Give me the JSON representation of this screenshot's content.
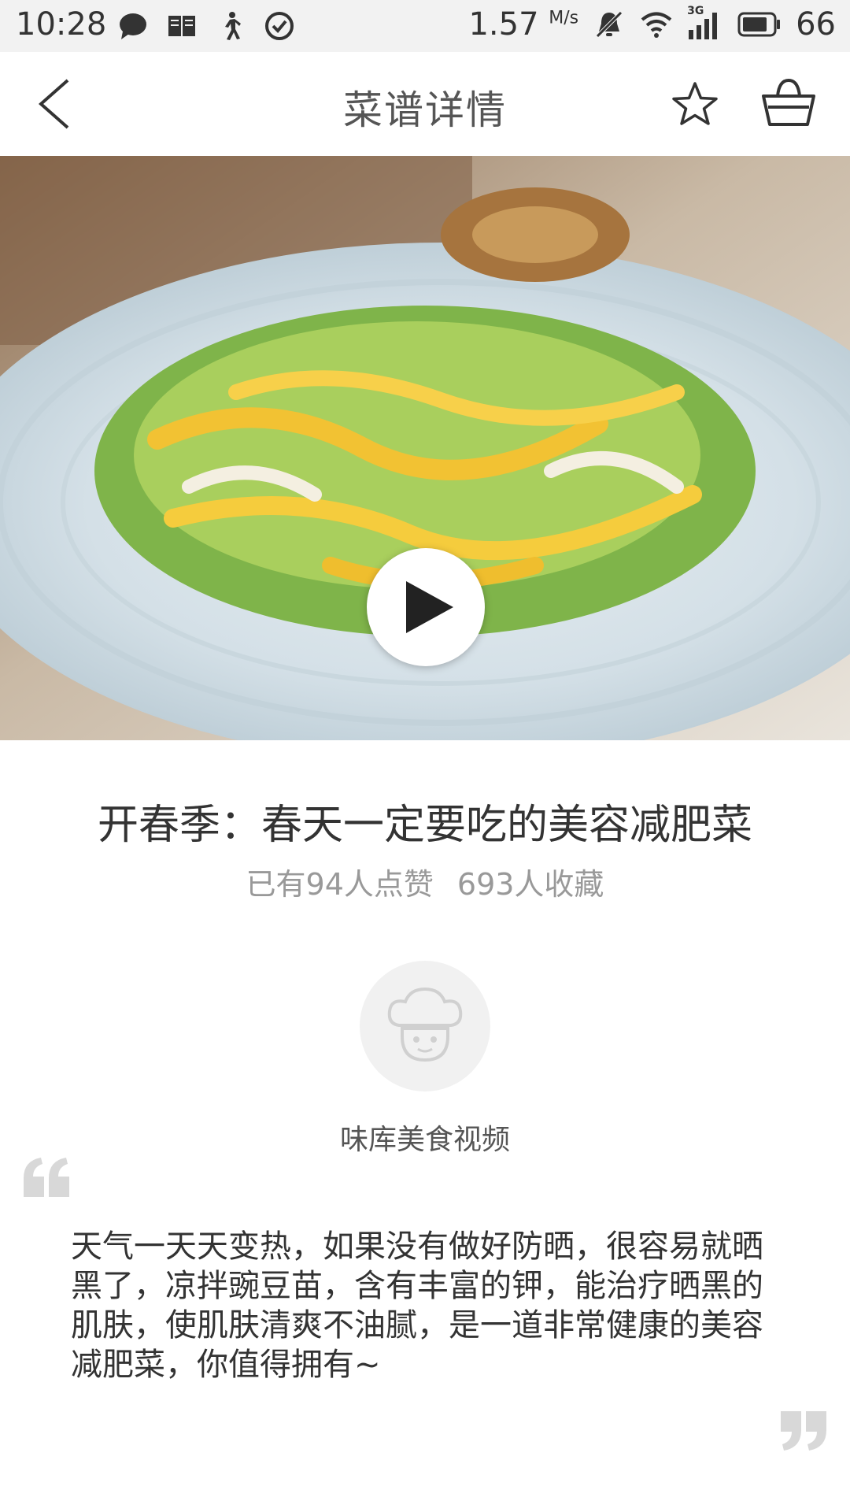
{
  "status_bar": {
    "time": "10:28",
    "speed": "1.57",
    "speed_unit": "M/s",
    "network": "3G",
    "battery": "66",
    "icons": [
      "message-icon",
      "book-icon",
      "walk-icon",
      "check-circle-icon",
      "bell-off-icon",
      "wifi-icon",
      "signal-icon",
      "battery-icon"
    ]
  },
  "header": {
    "title": "菜谱详情",
    "back_icon": "chevron-left-icon",
    "favorite_icon": "star-icon",
    "cart_icon": "basket-icon"
  },
  "hero": {
    "play_icon": "play-icon"
  },
  "recipe": {
    "title": "开春季：春天一定要吃的美容减肥菜",
    "likes": "已有94人点赞",
    "collects": "693人收藏"
  },
  "author": {
    "avatar_icon": "chef-avatar-icon",
    "name": "味库美食视频"
  },
  "description": {
    "text": "天气一天天变热，如果没有做好防晒，很容易就晒黑了，凉拌豌豆苗，含有丰富的钾，能治疗晒黑的肌肤，使肌肤清爽不油腻，是一道非常健康的美容减肥菜，你值得拥有~"
  },
  "colors": {
    "status_bg": "#f2f2f2",
    "title_text": "#555555",
    "muted_text": "#999999",
    "quote_mark": "#d8d8d8"
  }
}
